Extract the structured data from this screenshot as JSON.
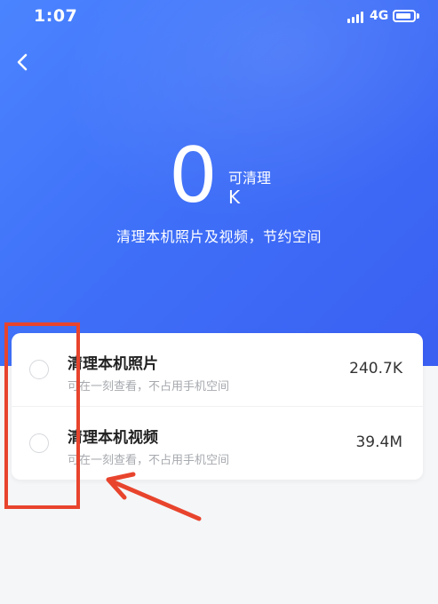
{
  "status_bar": {
    "time": "1:07",
    "network": "4G"
  },
  "header": {
    "back_icon": "chevron-left-icon"
  },
  "summary": {
    "amount": "0",
    "label": "可清理",
    "unit": "K",
    "subtitle": "清理本机照片及视频，节约空间"
  },
  "options": [
    {
      "title": "清理本机照片",
      "description": "可在一刻查看，不占用手机空间",
      "size": "240.7K",
      "selected": false
    },
    {
      "title": "清理本机视频",
      "description": "可在一刻查看，不占用手机空间",
      "size": "39.4M",
      "selected": false
    }
  ],
  "colors": {
    "hero_gradient_start": "#4b84ff",
    "hero_gradient_end": "#3a5ff2",
    "annotation_red": "#e8442d"
  }
}
